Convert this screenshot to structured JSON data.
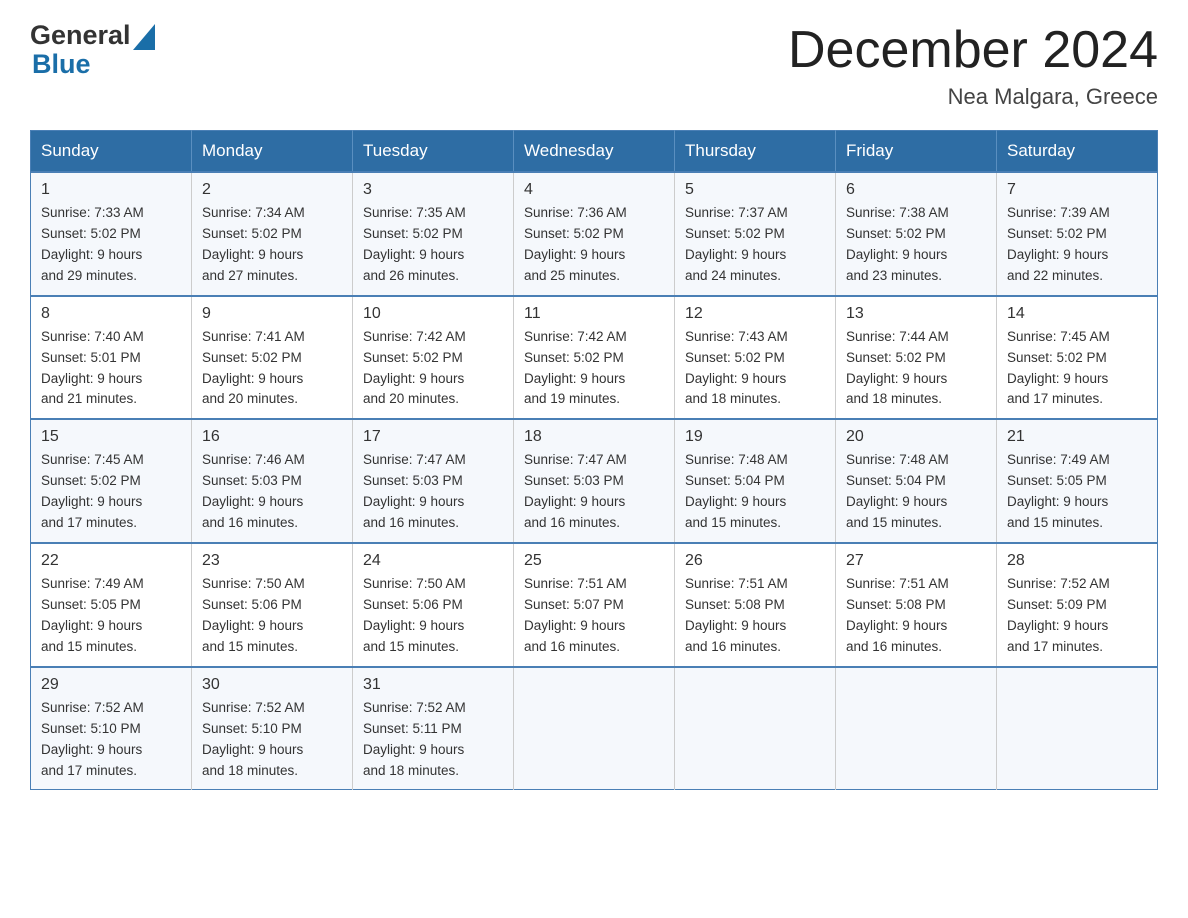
{
  "header": {
    "title": "December 2024",
    "subtitle": "Nea Malgara, Greece",
    "logo": {
      "general": "General",
      "blue": "Blue"
    }
  },
  "weekdays": [
    "Sunday",
    "Monday",
    "Tuesday",
    "Wednesday",
    "Thursday",
    "Friday",
    "Saturday"
  ],
  "weeks": [
    [
      {
        "day": "1",
        "sunrise": "7:33 AM",
        "sunset": "5:02 PM",
        "daylight": "9 hours and 29 minutes."
      },
      {
        "day": "2",
        "sunrise": "7:34 AM",
        "sunset": "5:02 PM",
        "daylight": "9 hours and 27 minutes."
      },
      {
        "day": "3",
        "sunrise": "7:35 AM",
        "sunset": "5:02 PM",
        "daylight": "9 hours and 26 minutes."
      },
      {
        "day": "4",
        "sunrise": "7:36 AM",
        "sunset": "5:02 PM",
        "daylight": "9 hours and 25 minutes."
      },
      {
        "day": "5",
        "sunrise": "7:37 AM",
        "sunset": "5:02 PM",
        "daylight": "9 hours and 24 minutes."
      },
      {
        "day": "6",
        "sunrise": "7:38 AM",
        "sunset": "5:02 PM",
        "daylight": "9 hours and 23 minutes."
      },
      {
        "day": "7",
        "sunrise": "7:39 AM",
        "sunset": "5:02 PM",
        "daylight": "9 hours and 22 minutes."
      }
    ],
    [
      {
        "day": "8",
        "sunrise": "7:40 AM",
        "sunset": "5:01 PM",
        "daylight": "9 hours and 21 minutes."
      },
      {
        "day": "9",
        "sunrise": "7:41 AM",
        "sunset": "5:02 PM",
        "daylight": "9 hours and 20 minutes."
      },
      {
        "day": "10",
        "sunrise": "7:42 AM",
        "sunset": "5:02 PM",
        "daylight": "9 hours and 20 minutes."
      },
      {
        "day": "11",
        "sunrise": "7:42 AM",
        "sunset": "5:02 PM",
        "daylight": "9 hours and 19 minutes."
      },
      {
        "day": "12",
        "sunrise": "7:43 AM",
        "sunset": "5:02 PM",
        "daylight": "9 hours and 18 minutes."
      },
      {
        "day": "13",
        "sunrise": "7:44 AM",
        "sunset": "5:02 PM",
        "daylight": "9 hours and 18 minutes."
      },
      {
        "day": "14",
        "sunrise": "7:45 AM",
        "sunset": "5:02 PM",
        "daylight": "9 hours and 17 minutes."
      }
    ],
    [
      {
        "day": "15",
        "sunrise": "7:45 AM",
        "sunset": "5:02 PM",
        "daylight": "9 hours and 17 minutes."
      },
      {
        "day": "16",
        "sunrise": "7:46 AM",
        "sunset": "5:03 PM",
        "daylight": "9 hours and 16 minutes."
      },
      {
        "day": "17",
        "sunrise": "7:47 AM",
        "sunset": "5:03 PM",
        "daylight": "9 hours and 16 minutes."
      },
      {
        "day": "18",
        "sunrise": "7:47 AM",
        "sunset": "5:03 PM",
        "daylight": "9 hours and 16 minutes."
      },
      {
        "day": "19",
        "sunrise": "7:48 AM",
        "sunset": "5:04 PM",
        "daylight": "9 hours and 15 minutes."
      },
      {
        "day": "20",
        "sunrise": "7:48 AM",
        "sunset": "5:04 PM",
        "daylight": "9 hours and 15 minutes."
      },
      {
        "day": "21",
        "sunrise": "7:49 AM",
        "sunset": "5:05 PM",
        "daylight": "9 hours and 15 minutes."
      }
    ],
    [
      {
        "day": "22",
        "sunrise": "7:49 AM",
        "sunset": "5:05 PM",
        "daylight": "9 hours and 15 minutes."
      },
      {
        "day": "23",
        "sunrise": "7:50 AM",
        "sunset": "5:06 PM",
        "daylight": "9 hours and 15 minutes."
      },
      {
        "day": "24",
        "sunrise": "7:50 AM",
        "sunset": "5:06 PM",
        "daylight": "9 hours and 15 minutes."
      },
      {
        "day": "25",
        "sunrise": "7:51 AM",
        "sunset": "5:07 PM",
        "daylight": "9 hours and 16 minutes."
      },
      {
        "day": "26",
        "sunrise": "7:51 AM",
        "sunset": "5:08 PM",
        "daylight": "9 hours and 16 minutes."
      },
      {
        "day": "27",
        "sunrise": "7:51 AM",
        "sunset": "5:08 PM",
        "daylight": "9 hours and 16 minutes."
      },
      {
        "day": "28",
        "sunrise": "7:52 AM",
        "sunset": "5:09 PM",
        "daylight": "9 hours and 17 minutes."
      }
    ],
    [
      {
        "day": "29",
        "sunrise": "7:52 AM",
        "sunset": "5:10 PM",
        "daylight": "9 hours and 17 minutes."
      },
      {
        "day": "30",
        "sunrise": "7:52 AM",
        "sunset": "5:10 PM",
        "daylight": "9 hours and 18 minutes."
      },
      {
        "day": "31",
        "sunrise": "7:52 AM",
        "sunset": "5:11 PM",
        "daylight": "9 hours and 18 minutes."
      },
      null,
      null,
      null,
      null
    ]
  ],
  "labels": {
    "sunrise": "Sunrise:",
    "sunset": "Sunset:",
    "daylight": "Daylight:"
  }
}
